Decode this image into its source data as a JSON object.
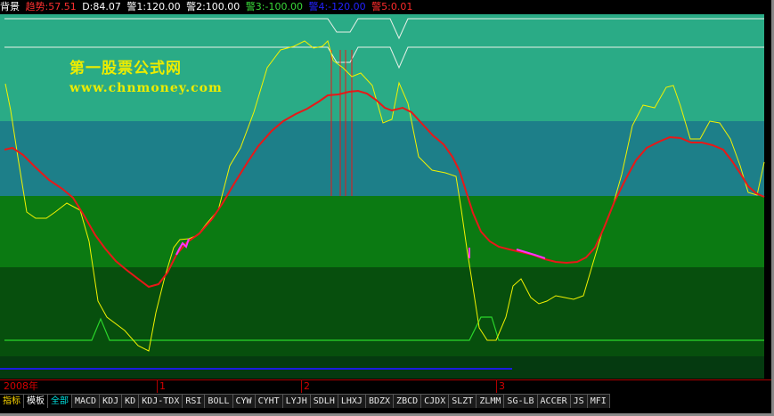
{
  "legend": [
    {
      "text": "背景",
      "color": "#ffffff"
    },
    {
      "text": "趋势:57.51",
      "color": "#ff3030"
    },
    {
      "text": "D:84.07",
      "color": "#ffffff"
    },
    {
      "text": "警1:120.00",
      "color": "#ffffff"
    },
    {
      "text": "警2:100.00",
      "color": "#ffffff"
    },
    {
      "text": "警3:-100.00",
      "color": "#39d939"
    },
    {
      "text": "警4:-120.00",
      "color": "#2222ff"
    },
    {
      "text": "警5:0.01",
      "color": "#ff2b2b"
    }
  ],
  "watermark": {
    "title": "第一股票公式网",
    "url": "www.chnmoney.com"
  },
  "time_axis": {
    "start_label": "2008年",
    "month_labels": [
      "1",
      "2",
      "3"
    ]
  },
  "tabs": [
    "指标",
    "模板",
    "全部",
    "MACD",
    "KDJ",
    "KD",
    "KDJ-TDX",
    "RSI",
    "BOLL",
    "CYW",
    "CYHT",
    "LYJH",
    "SDLH",
    "LHXJ",
    "BDZX",
    "ZBCD",
    "CJDX",
    "SLZT",
    "ZLMM",
    "SG-LB",
    "ACCER",
    "JS",
    "MFI"
  ],
  "colors": {
    "band_top": "#2aab86",
    "band_teal": "#1d7f89",
    "band_green": "#0b7a12",
    "band_dark": "#074f0d",
    "band_darkest": "#053a10",
    "trend_line": "#e81818",
    "d_line": "#f2f200",
    "warn_line": "#e8f0e8",
    "signal_line": "#2bd62b",
    "blue_line": "#1b1be0",
    "marker": "#ff33ff"
  }
}
